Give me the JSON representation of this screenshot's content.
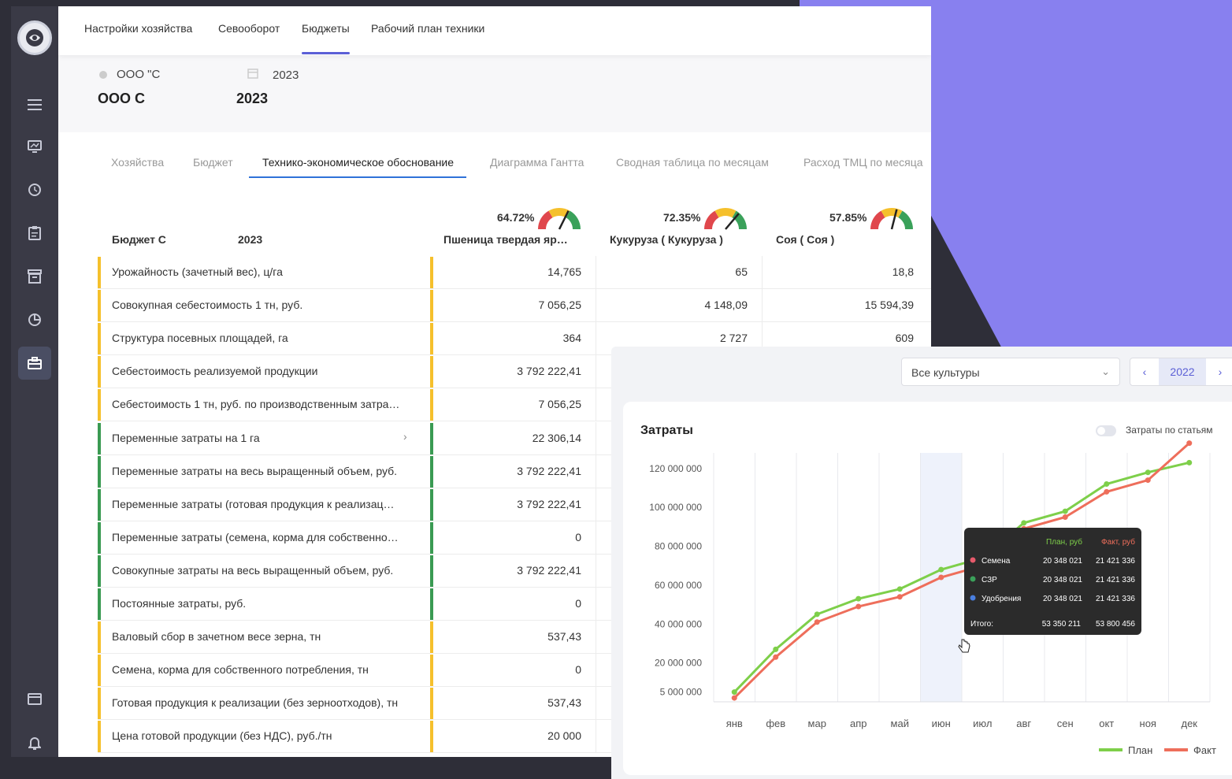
{
  "topnav": {
    "items": [
      "Настройки хозяйства",
      "Севооборот",
      "Бюджеты",
      "Рабочий план техники"
    ],
    "active": "Бюджеты"
  },
  "header": {
    "farm_select": "ООО \"С",
    "year_select": "2023",
    "farm_title": "ООО С",
    "year_title": "2023"
  },
  "subtabs": [
    "Хозяйства",
    "Бюджет",
    "Технико-экономическое обоснование",
    "Диаграмма Гантта",
    "Сводная таблица по месяцам",
    "Расход ТМЦ по месяца"
  ],
  "table": {
    "title": "Бюджет С",
    "title_year": "2023",
    "columns": [
      {
        "pct": "64.72%",
        "name": "Пшеница твердая яр…",
        "gauge_value": 64.72
      },
      {
        "pct": "72.35%",
        "name": "Кукуруза ( Кукуруза )",
        "gauge_value": 72.35
      },
      {
        "pct": "57.85%",
        "name": "Соя ( Соя )",
        "gauge_value": 57.85
      }
    ],
    "rows": [
      {
        "label": "Урожайность (зачетный вес), ц/га",
        "color": "#f5c02c",
        "v": [
          "14,765",
          "65",
          "18,8"
        ]
      },
      {
        "label": "Совокупная себестоимость 1 тн, руб.",
        "color": "#f5c02c",
        "v": [
          "7 056,25",
          "4 148,09",
          "15 594,39"
        ]
      },
      {
        "label": "Структура посевных площадей, га",
        "color": "#f5c02c",
        "v": [
          "364",
          "2 727",
          "609"
        ]
      },
      {
        "label": "Себестоимость реализуемой продукции",
        "color": "#f5c02c",
        "v": [
          "3 792 222,41",
          "",
          ""
        ]
      },
      {
        "label": "Себестоимость 1 тн, руб. по производственным затра…",
        "color": "#f5c02c",
        "v": [
          "7 056,25",
          "",
          ""
        ]
      },
      {
        "label": "Переменные затраты на 1 га",
        "color": "#3a9a52",
        "chevron": "›",
        "v": [
          "22 306,14",
          "",
          ""
        ]
      },
      {
        "label": "Переменные затраты на весь выращенный объем, руб.",
        "color": "#3a9a52",
        "v": [
          "3 792 222,41",
          "",
          ""
        ]
      },
      {
        "label": "Переменные затраты (готовая продукция к реализац…",
        "color": "#3a9a52",
        "v": [
          "3 792 222,41",
          "",
          ""
        ]
      },
      {
        "label": "Переменные затраты (семена, корма для собственно…",
        "color": "#3a9a52",
        "v": [
          "0",
          "",
          ""
        ]
      },
      {
        "label": "Совокупные затраты на весь выращенный объем, руб.",
        "color": "#3a9a52",
        "v": [
          "3 792 222,41",
          "",
          ""
        ]
      },
      {
        "label": "Постоянные затраты, руб.",
        "color": "#3a9a52",
        "v": [
          "0",
          "",
          ""
        ]
      },
      {
        "label": "Валовый сбор в зачетном весе зерна, тн",
        "color": "#f5c02c",
        "v": [
          "537,43",
          "",
          ""
        ]
      },
      {
        "label": "Семена, корма для собственного потребления, тн",
        "color": "#f5c02c",
        "v": [
          "0",
          "",
          ""
        ]
      },
      {
        "label": "Готовая продукция к реализации (без зерноотходов), тн",
        "color": "#f5c02c",
        "v": [
          "537,43",
          "",
          ""
        ]
      },
      {
        "label": "Цена готовой продукции (без НДС), руб./тн",
        "color": "#f5c02c",
        "v": [
          "20 000",
          "",
          ""
        ]
      }
    ]
  },
  "chart_panel": {
    "dropdown": "Все культуры",
    "year": "2022",
    "prev": "‹",
    "next": "›",
    "title": "Затраты",
    "toggle_label": "Затраты по статьям",
    "tooltip": {
      "head_plan": "План, руб",
      "head_fact": "Факт, руб",
      "rows": [
        {
          "name": "Семена",
          "dot": "#e65a6b",
          "plan": "20 348 021",
          "fact": "21 421 336"
        },
        {
          "name": "СЗР",
          "dot": "#3aa15a",
          "plan": "20 348 021",
          "fact": "21 421 336"
        },
        {
          "name": "Удобрения",
          "dot": "#4a7fe0",
          "plan": "20 348 021",
          "fact": "21 421 336"
        }
      ],
      "total_label": "Итого:",
      "total_plan": "53 350 211",
      "total_fact": "53 800 456"
    }
  },
  "chart_data": {
    "type": "line",
    "title": "Затраты",
    "categories": [
      "янв",
      "фев",
      "мар",
      "апр",
      "май",
      "июн",
      "июл",
      "авг",
      "сен",
      "окт",
      "ноя",
      "дек"
    ],
    "y_ticks": [
      "5 000 000",
      "20 000 000",
      "40 000 000",
      "60 000 000",
      "80 000 000",
      "100 000 000",
      "120 000 000"
    ],
    "y_tick_values": [
      5000000,
      20000000,
      40000000,
      60000000,
      80000000,
      100000000,
      120000000
    ],
    "ylim": [
      0,
      128000000
    ],
    "highlight_category": "июн",
    "series": [
      {
        "name": "План",
        "color": "#7ecf4a",
        "values": [
          5000000,
          27000000,
          45000000,
          53000000,
          58000000,
          68000000,
          74000000,
          92000000,
          98000000,
          112000000,
          118000000,
          123000000
        ]
      },
      {
        "name": "Факт",
        "color": "#ee6e5b",
        "values": [
          2000000,
          23000000,
          41000000,
          49000000,
          54000000,
          64000000,
          70000000,
          89000000,
          95000000,
          108000000,
          114000000,
          133000000
        ]
      }
    ],
    "legend": [
      "План",
      "Факт"
    ],
    "legend_position": "bottom-right"
  }
}
